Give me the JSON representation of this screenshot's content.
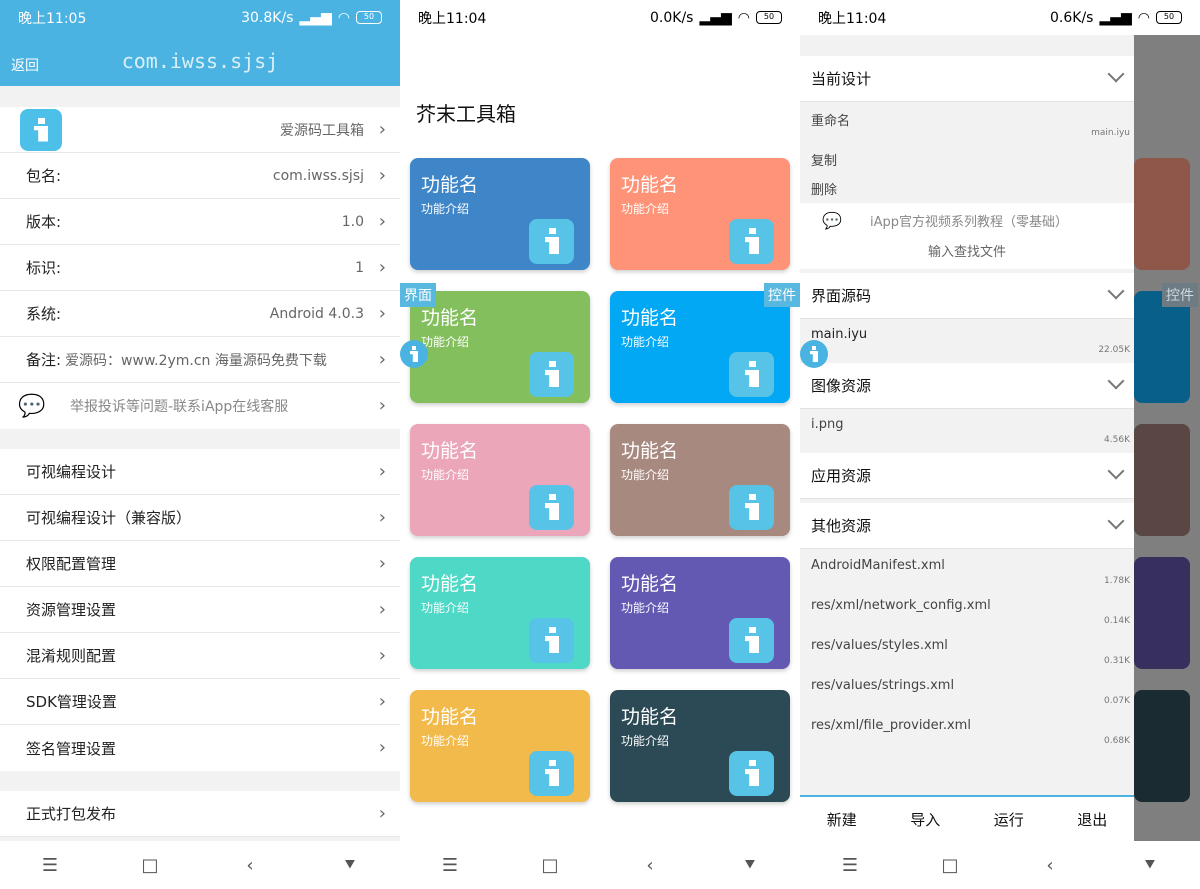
{
  "status": [
    {
      "time": "晚上11:05",
      "speed": "30.8K/s",
      "battery": "50"
    },
    {
      "time": "晚上11:04",
      "speed": "0.0K/s",
      "battery": "50"
    },
    {
      "time": "晚上11:04",
      "speed": "0.6K/s",
      "battery": "50"
    }
  ],
  "nav": {
    "menu": "☰",
    "home": "□",
    "back": "‹",
    "assist": "⯆"
  },
  "p1": {
    "back": "返回",
    "title": "com.iwss.sjsj",
    "app_name": "爱源码工具箱",
    "info": [
      {
        "label": "包名:",
        "value": "com.iwss.sjsj"
      },
      {
        "label": "版本:",
        "value": "1.0"
      },
      {
        "label": "标识:",
        "value": "1"
      },
      {
        "label": "系统:",
        "value": "Android 4.0.3"
      },
      {
        "label": "备注:",
        "value": "爱源码：www.2ym.cn 海量源码免费下载"
      }
    ],
    "report": "举报投诉等问题-联系iApp在线客服",
    "menu": [
      "可视编程设计",
      "可视编程设计（兼容版）",
      "权限配置管理",
      "资源管理设置",
      "混淆规则配置",
      "SDK管理设置",
      "签名管理设置"
    ],
    "publish": "正式打包发布",
    "chevron": "›"
  },
  "p2": {
    "title": "芥末工具箱",
    "cards": [
      {
        "name": "功能名",
        "desc": "功能介绍",
        "color": "#3f86c8"
      },
      {
        "name": "功能名",
        "desc": "功能介绍",
        "color": "#fe9378"
      },
      {
        "name": "功能名",
        "desc": "功能介绍",
        "color": "#84bf5e"
      },
      {
        "name": "功能名",
        "desc": "功能介绍",
        "color": "#02a8f3"
      },
      {
        "name": "功能名",
        "desc": "功能介绍",
        "color": "#eba6b9"
      },
      {
        "name": "功能名",
        "desc": "功能介绍",
        "color": "#a88980"
      },
      {
        "name": "功能名",
        "desc": "功能介绍",
        "color": "#4ed8c6"
      },
      {
        "name": "功能名",
        "desc": "功能介绍",
        "color": "#6359b3"
      },
      {
        "name": "功能名",
        "desc": "功能介绍",
        "color": "#f2b94b"
      },
      {
        "name": "功能名",
        "desc": "功能介绍",
        "color": "#2b4a55"
      }
    ],
    "tag_left": "界面",
    "tag_right": "控件"
  },
  "p3": {
    "current": "当前设计",
    "rename": "重命名",
    "current_file": "main.iyu",
    "copy": "复制",
    "delete": "删除",
    "tutorial": "iApp官方视频系列教程（零基础）",
    "search": "输入查找文件",
    "ui_src": "界面源码",
    "ui_file": "main.iyu",
    "ui_size": "22.05K",
    "images": "图像资源",
    "img_file": "i.png",
    "img_size": "4.56K",
    "app_res": "应用资源",
    "other": "其他资源",
    "files": [
      {
        "name": "AndroidManifest.xml",
        "size": "1.78K"
      },
      {
        "name": "res/xml/network_config.xml",
        "size": "0.14K"
      },
      {
        "name": "res/values/styles.xml",
        "size": "0.31K"
      },
      {
        "name": "res/values/strings.xml",
        "size": "0.07K"
      },
      {
        "name": "res/xml/file_provider.xml",
        "size": "0.68K"
      }
    ],
    "bottom": [
      "新建",
      "导入",
      "运行",
      "退出"
    ],
    "tag_right": "控件"
  }
}
